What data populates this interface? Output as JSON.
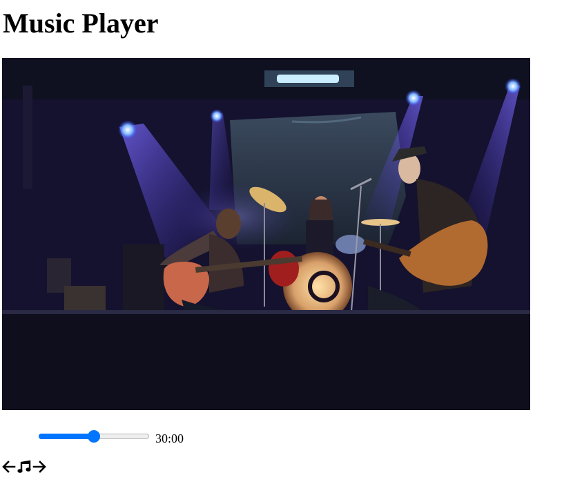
{
  "page": {
    "title": "Music Player"
  },
  "player": {
    "album_art_alt": "",
    "progress_fraction": 0.5,
    "time_display": "30:00"
  },
  "controls": {
    "previous_icon": "arrow-left-icon",
    "play_icon": "music-note-icon",
    "next_icon": "arrow-right-icon"
  },
  "colors": {
    "accent": "#0075ff",
    "track": "#efefef"
  }
}
